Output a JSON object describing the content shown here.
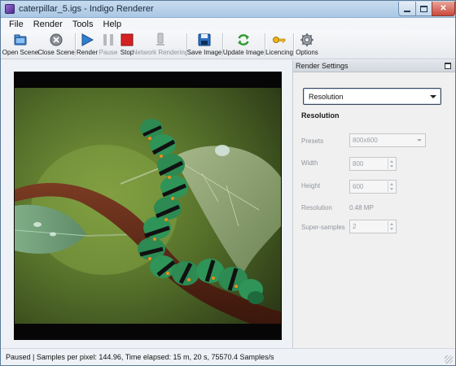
{
  "window": {
    "title": "caterpillar_5.igs - Indigo Renderer",
    "controls": {
      "minimize": "",
      "maximize": "",
      "close": "✕"
    }
  },
  "menu": [
    "File",
    "Render",
    "Tools",
    "Help"
  ],
  "toolbar": {
    "open_scene": "Open Scene",
    "close_scene": "Close Scene",
    "render": "Render",
    "pause": "Pause",
    "stop": "Stop",
    "network_rendering": "Network Rendering",
    "save_image": "Save Image",
    "update_image": "Update Image",
    "licencing": "Licencing",
    "options": "Options"
  },
  "icons": {
    "open_scene": "folder-icon",
    "close_scene": "close-scene-icon",
    "render": "play-icon",
    "pause": "pause-icon",
    "stop": "stop-icon",
    "network_rendering": "network-icon",
    "save_image": "floppy-disk-icon",
    "update_image": "refresh-icon",
    "licencing": "key-icon",
    "options": "gear-icon"
  },
  "settings_panel": {
    "title": "Render Settings",
    "section_dropdown": "Resolution",
    "section_heading": "Resolution",
    "presets": {
      "label": "Presets",
      "value": "800x600"
    },
    "width": {
      "label": "Width",
      "value": "800"
    },
    "height": {
      "label": "Height",
      "value": "600"
    },
    "resolution": {
      "label": "Resolution",
      "value": "0.48 MP"
    },
    "super_samples": {
      "label": "Super-samples",
      "value": "2"
    }
  },
  "status": {
    "text": "Paused | Samples per pixel: 144.96, Time elapsed: 15 m, 20 s, 75570.4 Samples/s"
  },
  "colors": {
    "title_bar": "#aac7e4",
    "close_button": "#c9483a",
    "render_frame": "#060606",
    "stop_red": "#d42222",
    "play_blue": "#2f7fd1"
  }
}
